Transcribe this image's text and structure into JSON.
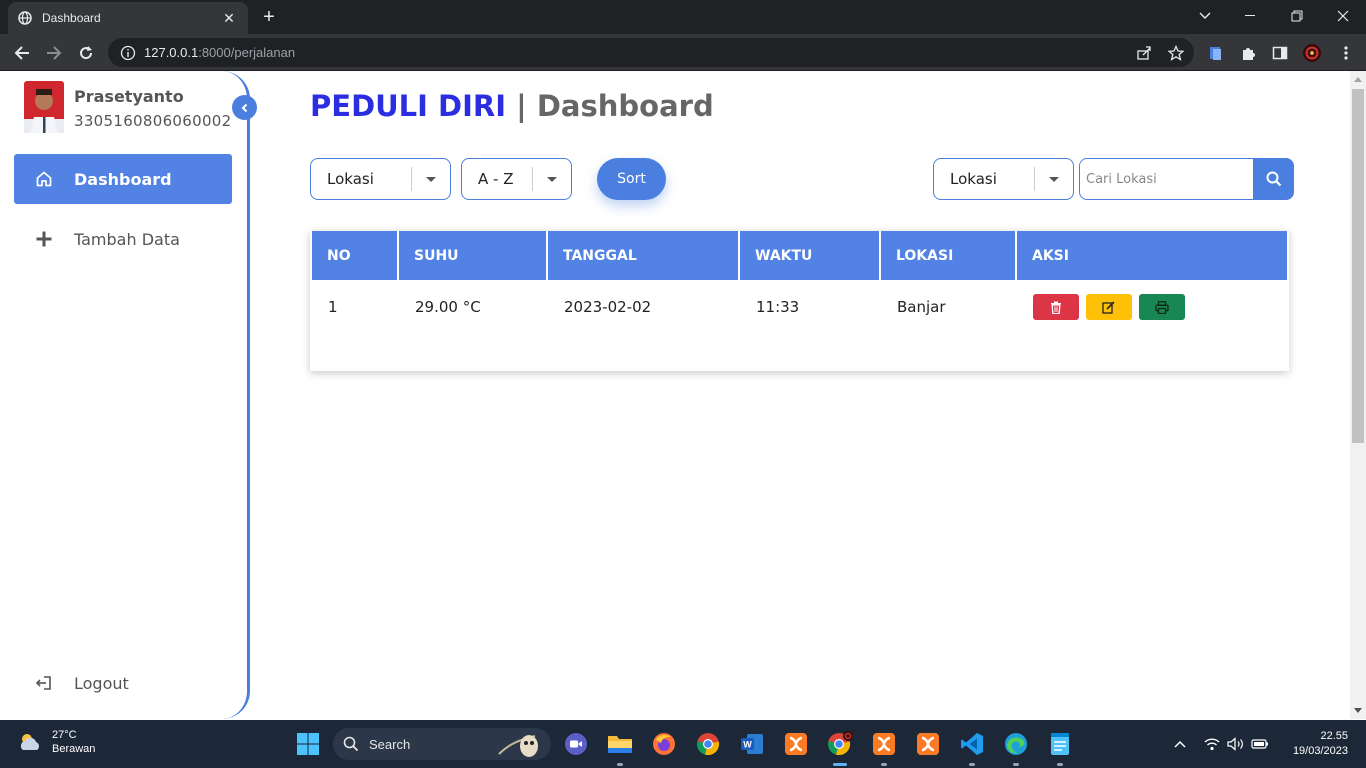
{
  "browser": {
    "tab_title": "Dashboard",
    "url_host": "127.0.0.1",
    "url_rest": ":8000/perjalanan"
  },
  "sidebar": {
    "user_name": "Prasetyanto",
    "user_id": "3305160806060002",
    "nav": [
      {
        "label": "Dashboard",
        "icon": "home-icon",
        "active": true
      },
      {
        "label": "Tambah Data",
        "icon": "plus-icon",
        "active": false
      }
    ],
    "logout_label": "Logout"
  },
  "header": {
    "brand": "PEDULI DIRI",
    "separator": "|",
    "page": "Dashboard"
  },
  "filters": {
    "sort_field": "Lokasi",
    "sort_order": "A - Z",
    "sort_button": "Sort",
    "search_field": "Lokasi",
    "search_placeholder": "Cari Lokasi"
  },
  "table": {
    "columns": [
      "NO",
      "SUHU",
      "TANGGAL",
      "WAKTU",
      "LOKASI",
      "AKSI"
    ],
    "rows": [
      {
        "no": "1",
        "suhu": "29.00 °C",
        "tanggal": "2023-02-02",
        "waktu": "11:33",
        "lokasi": "Banjar"
      }
    ]
  },
  "taskbar": {
    "temperature": "27°C",
    "weather": "Berawan",
    "search_label": "Search",
    "time": "22.55",
    "date": "19/03/2023"
  },
  "colors": {
    "accent": "#4a7fe0",
    "brand": "#2a2ee0",
    "delete": "#dc3545",
    "edit": "#ffc107",
    "print": "#198754"
  }
}
